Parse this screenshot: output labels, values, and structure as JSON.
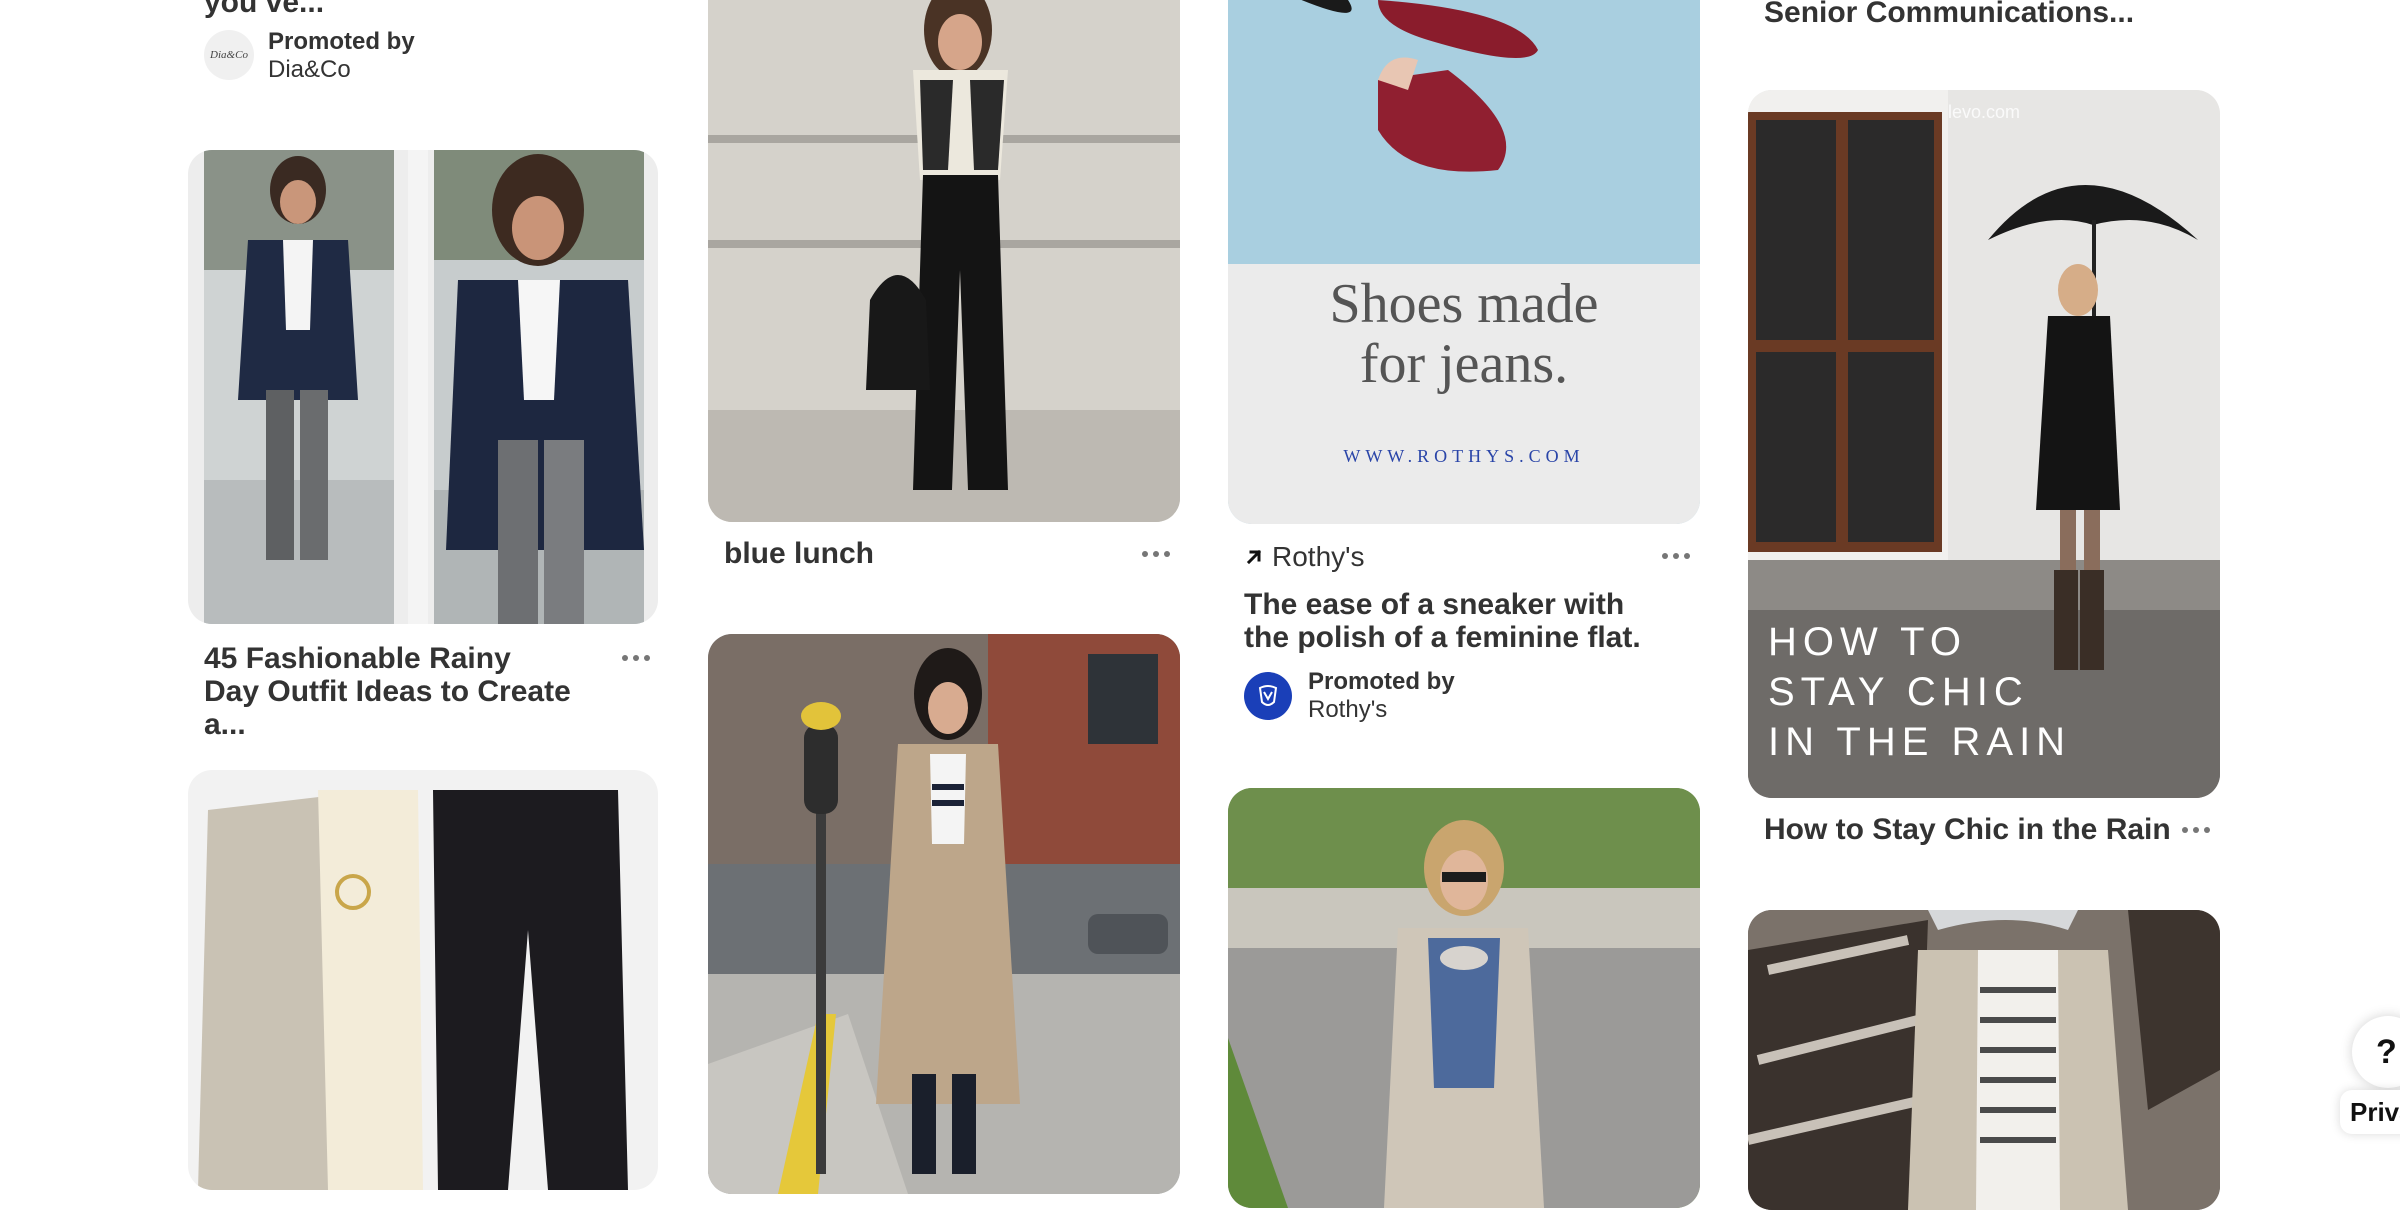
{
  "pins": {
    "c1_top": {
      "title_tail": "you ve...",
      "promoted_label": "Promoted by",
      "advertiser": "Dia&Co",
      "avatar_text": "Dia&Co"
    },
    "c1_rain": {
      "title": "45 Fashionable Rainy Day Outfit Ideas to Create a..."
    },
    "c2_lunch": {
      "title": "blue lunch"
    },
    "c3_rothys": {
      "headline_line1": "Shoes made",
      "headline_line2": "for jeans.",
      "url": "WWW.ROTHYS.COM",
      "domain": "Rothy's",
      "title": "The ease of a sneaker with the polish of a feminine flat.",
      "promoted_label": "Promoted by",
      "advertiser": "Rothy's"
    },
    "c4_top": {
      "title_tail": "Senior Communications..."
    },
    "c4_chic": {
      "watermark": "levo.com",
      "overlay_line1": "HOW TO",
      "overlay_line2": "STAY CHIC",
      "overlay_line3": "IN THE RAIN",
      "title": "How to Stay Chic in the Rain"
    }
  },
  "floating": {
    "help_label": "?",
    "privacy_label": "Priva"
  },
  "colors": {
    "rothys_blue": "#1a3fb8",
    "sky": "#a9cfe0",
    "text": "#333333",
    "more_dots": "#767676"
  },
  "icons": [
    "outbound-arrow-icon",
    "more-options-icon",
    "rothys-logo-icon",
    "help-icon"
  ]
}
